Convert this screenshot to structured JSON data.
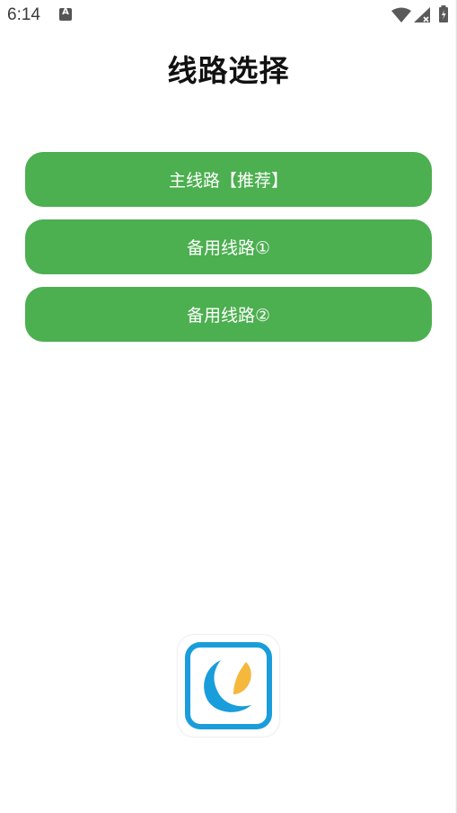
{
  "status_bar": {
    "time": "6:14",
    "notification_icon_letter": "A",
    "icons": [
      "a-notification-icon",
      "wifi-icon",
      "signal-icon",
      "battery-icon"
    ]
  },
  "page": {
    "title": "线路选择"
  },
  "routes": {
    "main_label": "主线路【推荐】",
    "backup1_label": "备用线路①",
    "backup2_label": "备用线路②"
  },
  "colors": {
    "button_green": "#4caf50",
    "logo_blue": "#1a9ddb",
    "logo_orange": "#f5b83d"
  },
  "logo": {
    "name": "app-logo-icon"
  }
}
